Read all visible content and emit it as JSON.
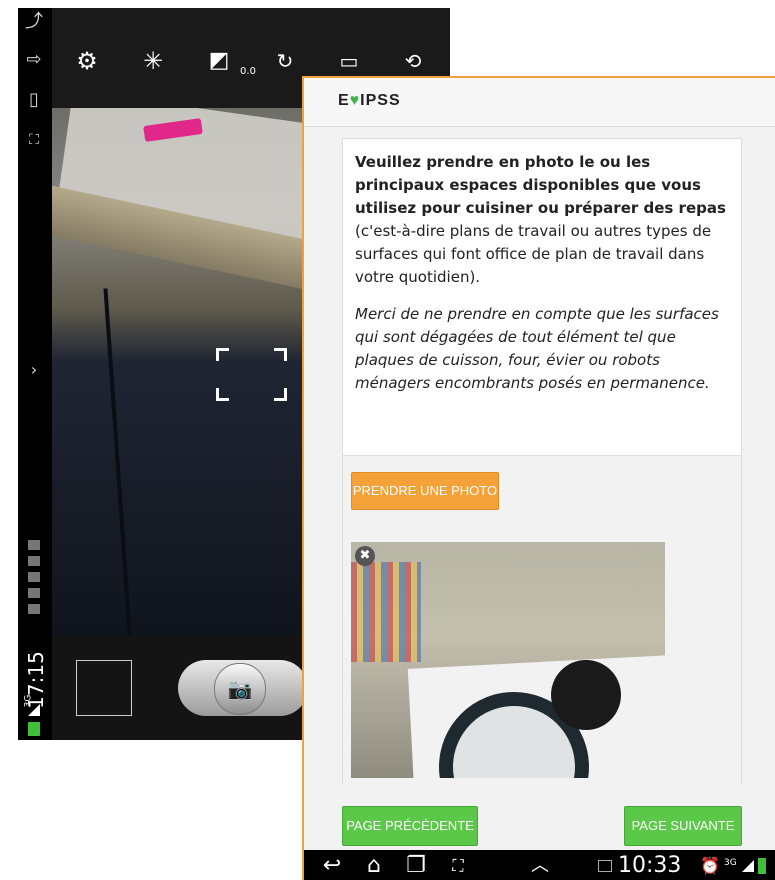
{
  "camera": {
    "status": {
      "time": "17:15",
      "network": "3G"
    },
    "toolbar": {
      "exposure_value": "0.0",
      "icons": [
        "settings-icon",
        "effects-icon",
        "exposure-icon",
        "timer-off-icon",
        "aspect-ratio-icon",
        "switch-camera-icon"
      ]
    },
    "shutter_icon": "📷"
  },
  "form": {
    "logo_prefix": "E",
    "logo_heart": "♥",
    "logo_suffix": "IPSS",
    "question_bold": "Veuillez prendre en photo le ou les principaux espaces disponibles que vous utilisez pour cuisiner ou préparer des repas",
    "question_rest": " (c'est-à-dire plans de travail ou autres types de surfaces qui font office de plan de travail dans votre quotidien).",
    "question_note": "Merci de ne prendre en compte que les surfaces qui sont dégagées de tout élément tel que plaques de cuisson, four, évier ou robots ménagers encombrants posés en permanence.",
    "photo_button": "PRENDRE UNE PHOTO",
    "remove_icon": "✖",
    "prev_button": "PAGE PRÉCÉDENTE",
    "next_button": "PAGE SUIVANTE"
  },
  "android_bar": {
    "time": "10:33",
    "network": "3G"
  },
  "colors": {
    "accent_orange": "#f5a13a",
    "nav_green": "#5bc84a",
    "logo_green": "#3db54a"
  }
}
